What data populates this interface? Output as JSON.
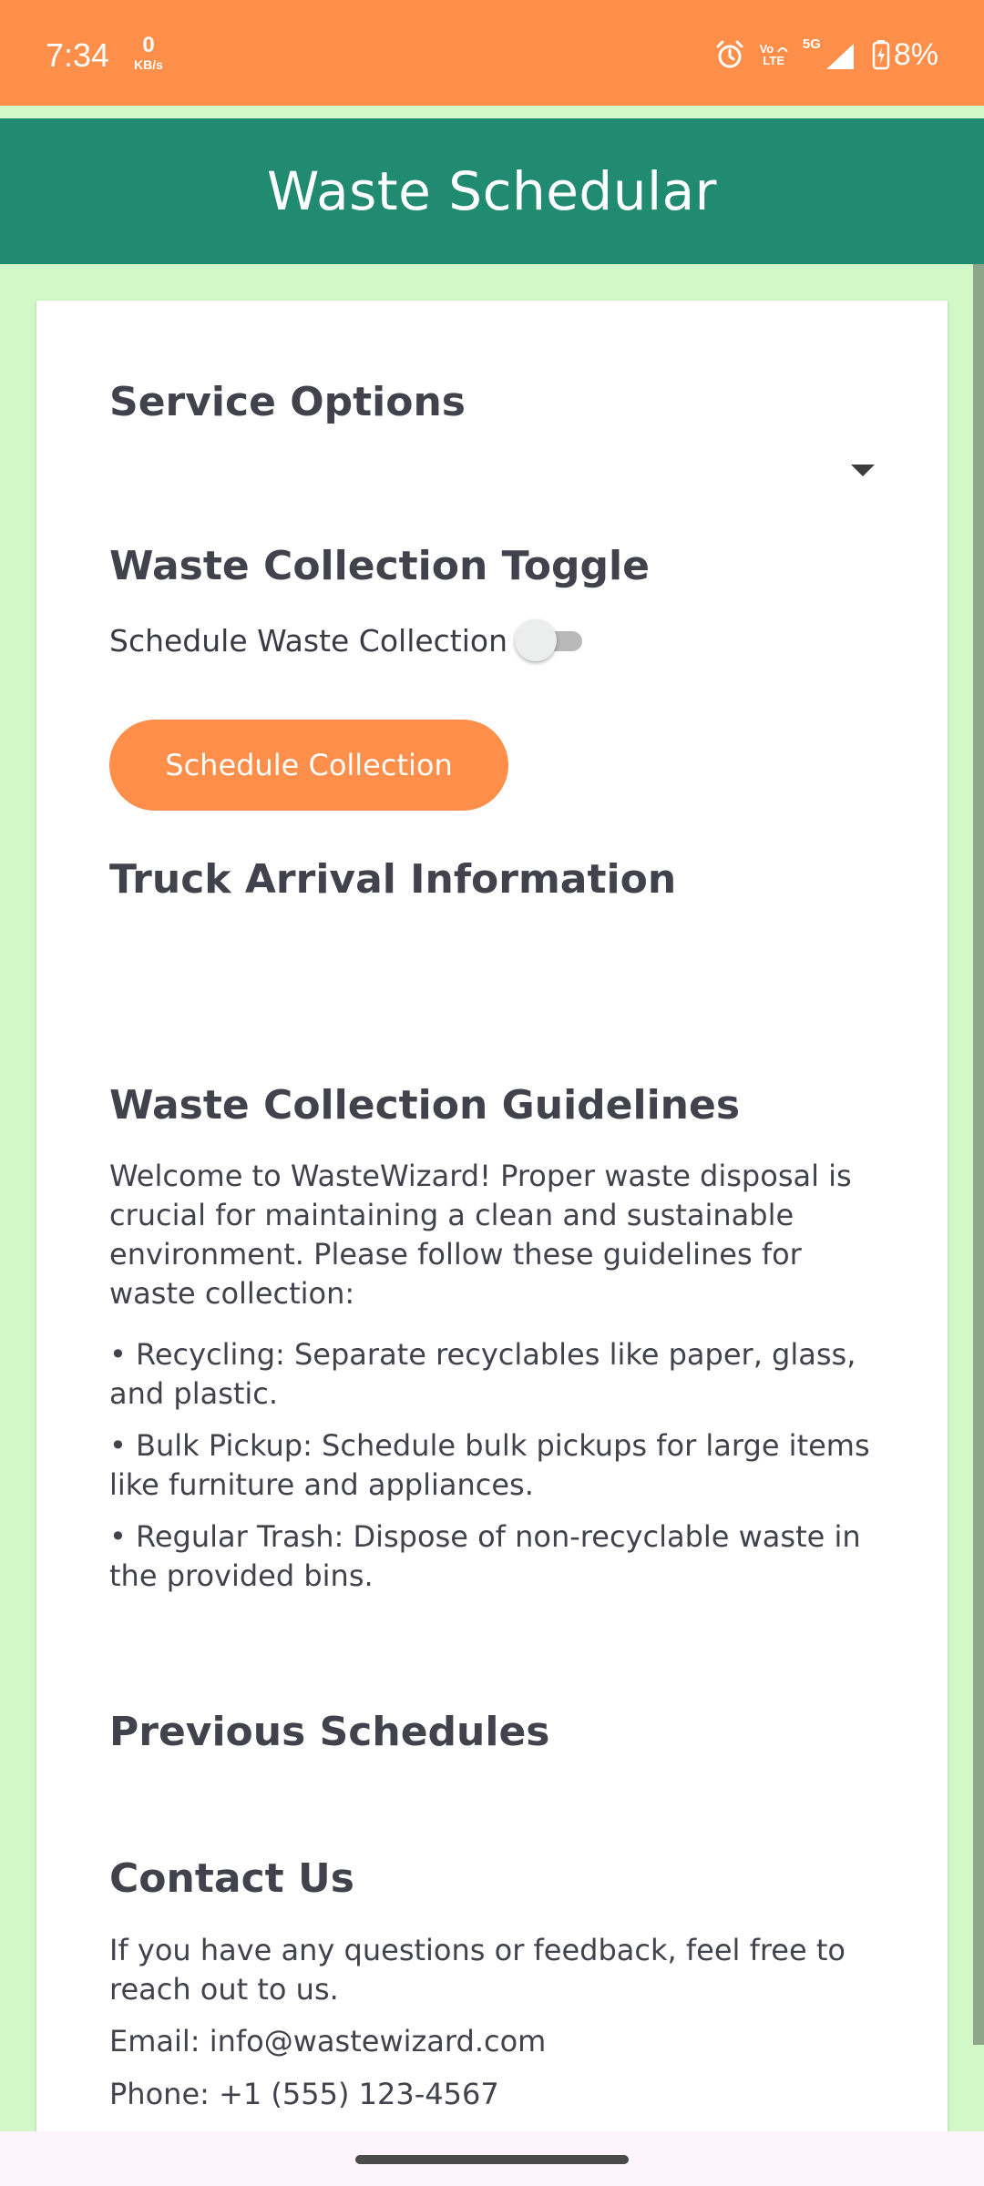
{
  "status_bar": {
    "time": "7:34",
    "net_speed_value": "0",
    "net_speed_unit": "KB/s",
    "volte_top": "Vo",
    "volte_bottom": "LTE",
    "network_type": "5G",
    "battery_percent": "8%",
    "icons": [
      "alarm-icon",
      "volte-icon",
      "signal-5g-icon",
      "battery-charging-icon"
    ]
  },
  "app_bar": {
    "title": "Waste Schedular"
  },
  "service_options": {
    "title": "Service Options",
    "selected_value": ""
  },
  "waste_toggle": {
    "title": "Waste Collection Toggle",
    "label": "Schedule Waste Collection",
    "checked": false
  },
  "schedule_button": {
    "label": "Schedule Collection"
  },
  "truck_info": {
    "title": "Truck Arrival Information"
  },
  "guidelines": {
    "title": "Waste Collection Guidelines",
    "intro": "Welcome to WasteWizard! Proper waste disposal is crucial for maintaining a clean and sustainable environment. Please follow these guidelines for waste collection:",
    "items": [
      "• Recycling: Separate recyclables like paper, glass, and plastic.",
      "• Bulk Pickup: Schedule bulk pickups for large items like furniture and appliances.",
      "• Regular Trash: Dispose of non-recyclable waste in the provided bins."
    ]
  },
  "previous_schedules": {
    "title": "Previous Schedules"
  },
  "contact": {
    "title": "Contact Us",
    "message": "If you have any questions or feedback, feel free to reach out to us.",
    "email": "Email: info@wastewizard.com",
    "phone": "Phone: +1 (555) 123-4567"
  },
  "colors": {
    "status_bar": "#fe8f4a",
    "app_bar": "#208b71",
    "page_background": "#d2f8c8",
    "accent_button": "#fe8f4a",
    "text": "#42424d"
  }
}
